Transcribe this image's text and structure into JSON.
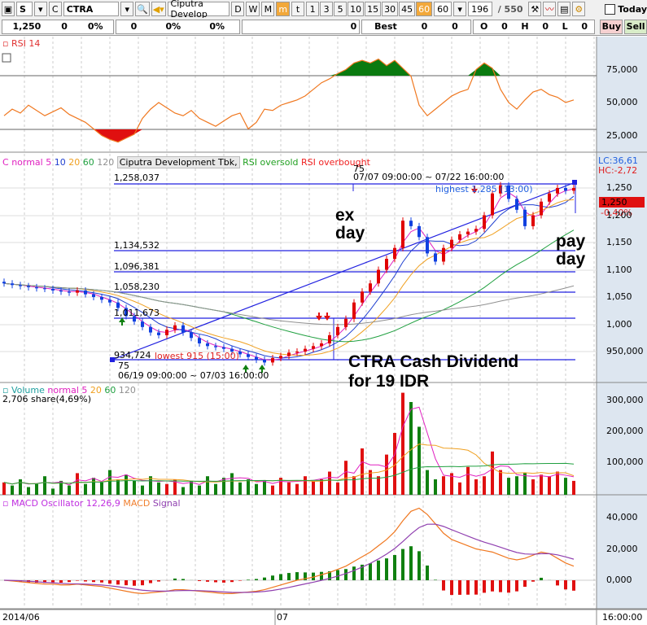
{
  "toolbar": {
    "market": "S",
    "type": "C",
    "symbol": "CTRA",
    "company": "Ciputra Develop",
    "periods": [
      "D",
      "W",
      "M",
      "m",
      "t"
    ],
    "active_period": "m",
    "minutes": [
      "1",
      "3",
      "5",
      "10",
      "15",
      "30",
      "45",
      "60"
    ],
    "active_minute": "60",
    "interval_value": "60",
    "count": "196",
    "total": "/ 550",
    "today_label": "Today"
  },
  "quote": {
    "price": "1,250",
    "change": "0",
    "change_pct": "0%",
    "v1": "0",
    "v1_pct": "0%",
    "v2_pct": "0%",
    "v3": "0",
    "best_label": "Best",
    "best_bid": "0",
    "best_ask": "0",
    "o_label": "O",
    "o": "0",
    "h_label": "H",
    "h": "0",
    "l_label": "L",
    "l": "0",
    "buy": "Buy",
    "sell": "Sell"
  },
  "rsi_panel": {
    "title": "RSI 14",
    "axis": [
      "75,000",
      "50,000",
      "25,000"
    ]
  },
  "price_panel": {
    "legend": {
      "c": "C",
      "normal": "normal",
      "ma5": "5",
      "ma10": "10",
      "ma20": "20",
      "ma60": "60",
      "ma120": "120",
      "name": "Ciputra Development Tbk,",
      "oversold": "RSI oversold",
      "overbought": "RSI overbought"
    },
    "lc": "LC:36,61",
    "hc": "HC:-2,72",
    "current": "1,250",
    "current_pct": "-0,40%",
    "axis": [
      "1,250",
      "1,200",
      "1,150",
      "1,100",
      "1,050",
      "1,000",
      "950,000"
    ],
    "levels": [
      "1,258,037",
      "1,134,532",
      "1,096,381",
      "1,058,230",
      "1,011,673",
      "934,724"
    ],
    "range_top_num": "75",
    "range_top": "07/07 09:00:00 ~ 07/22 16:00:00",
    "range_bot_num": "75",
    "range_bot": "06/19 09:00:00 ~ 07/03 16:00:00",
    "highest": "highest 1,285 (13:00)",
    "lowest": "lowest 915 (15:00)",
    "ann_ex": "ex day",
    "ann_ex2": "",
    "ann_pay": "pay day",
    "ann_div1": "CTRA Cash Dividend",
    "ann_div2": "for 19 IDR"
  },
  "volume_panel": {
    "title": "Volume",
    "normal": "normal",
    "ma5": "5",
    "ma20": "20",
    "ma60": "60",
    "ma120": "120",
    "info": "2,706 share(4,69%)",
    "axis": [
      "300,000",
      "200,000",
      "100,000"
    ]
  },
  "macd_panel": {
    "title": "MACD Oscillator 12,26,9",
    "macd": "MACD",
    "signal": "Signal",
    "axis": [
      "40,000",
      "20,000",
      "0,000"
    ]
  },
  "date_axis": {
    "start": "2014/06",
    "mid": "07",
    "end": "16:00:00"
  },
  "colors": {
    "up": "#e00000",
    "down": "#1040e0",
    "ma5": "#e020c0",
    "ma10": "#2040d0",
    "ma20": "#f0a020",
    "ma60": "#20a040",
    "ma120": "#909090",
    "level": "#2020e0"
  },
  "chart_data": {
    "type": "candlestick",
    "closes": [
      1075,
      1072,
      1070,
      1068,
      1066,
      1065,
      1062,
      1060,
      1058,
      1062,
      1055,
      1050,
      1045,
      1040,
      1030,
      1015,
      1005,
      995,
      985,
      980,
      990,
      998,
      985,
      975,
      965,
      960,
      958,
      955,
      950,
      945,
      940,
      935,
      930,
      938,
      942,
      948,
      950,
      955,
      960,
      965,
      980,
      995,
      1010,
      1040,
      1060,
      1075,
      1100,
      1120,
      1140,
      1190,
      1180,
      1160,
      1130,
      1115,
      1140,
      1155,
      1165,
      1170,
      1175,
      1200,
      1240,
      1255,
      1230,
      1210,
      1180,
      1200,
      1225,
      1240,
      1250,
      1245,
      1250
    ],
    "rsi": [
      40,
      45,
      42,
      48,
      44,
      40,
      43,
      46,
      41,
      38,
      35,
      30,
      25,
      22,
      20,
      23,
      26,
      38,
      45,
      50,
      46,
      42,
      40,
      44,
      38,
      35,
      32,
      36,
      40,
      42,
      30,
      35,
      45,
      44,
      48,
      50,
      52,
      55,
      60,
      65,
      68,
      72,
      75,
      80,
      82,
      80,
      83,
      78,
      82,
      76,
      70,
      48,
      40,
      45,
      50,
      55,
      58,
      60,
      75,
      80,
      76,
      60,
      50,
      45,
      52,
      58,
      60,
      56,
      54,
      50,
      52
    ],
    "volume_k": [
      40,
      30,
      50,
      25,
      35,
      60,
      20,
      45,
      30,
      70,
      35,
      55,
      40,
      80,
      50,
      65,
      45,
      30,
      60,
      40,
      35,
      50,
      25,
      45,
      30,
      60,
      35,
      55,
      70,
      40,
      50,
      35,
      45,
      30,
      55,
      40,
      35,
      60,
      45,
      50,
      75,
      40,
      110,
      60,
      150,
      80,
      60,
      130,
      200,
      330,
      300,
      220,
      80,
      50,
      60,
      70,
      40,
      90,
      50,
      60,
      140,
      80,
      55,
      60,
      70,
      50,
      65,
      60,
      75,
      55,
      45
    ],
    "macd": [
      0,
      -500,
      -1000,
      -1500,
      -2000,
      -2500,
      -2500,
      -3000,
      -3000,
      -2500,
      -3000,
      -3500,
      -4000,
      -5000,
      -6000,
      -7000,
      -8000,
      -8500,
      -8000,
      -7500,
      -7000,
      -6000,
      -6000,
      -6500,
      -7000,
      -7500,
      -8000,
      -8500,
      -8500,
      -8000,
      -7500,
      -7000,
      -6000,
      -4500,
      -3000,
      -1500,
      0,
      1000,
      2000,
      3500,
      5000,
      7000,
      9000,
      12000,
      15000,
      18000,
      22000,
      26000,
      31000,
      38000,
      44000,
      46000,
      42000,
      36000,
      30000,
      26000,
      24000,
      22000,
      20000,
      19000,
      18000,
      16000,
      14000,
      13000,
      14000,
      16000,
      18000,
      17000,
      14000,
      11000,
      9000
    ]
  }
}
